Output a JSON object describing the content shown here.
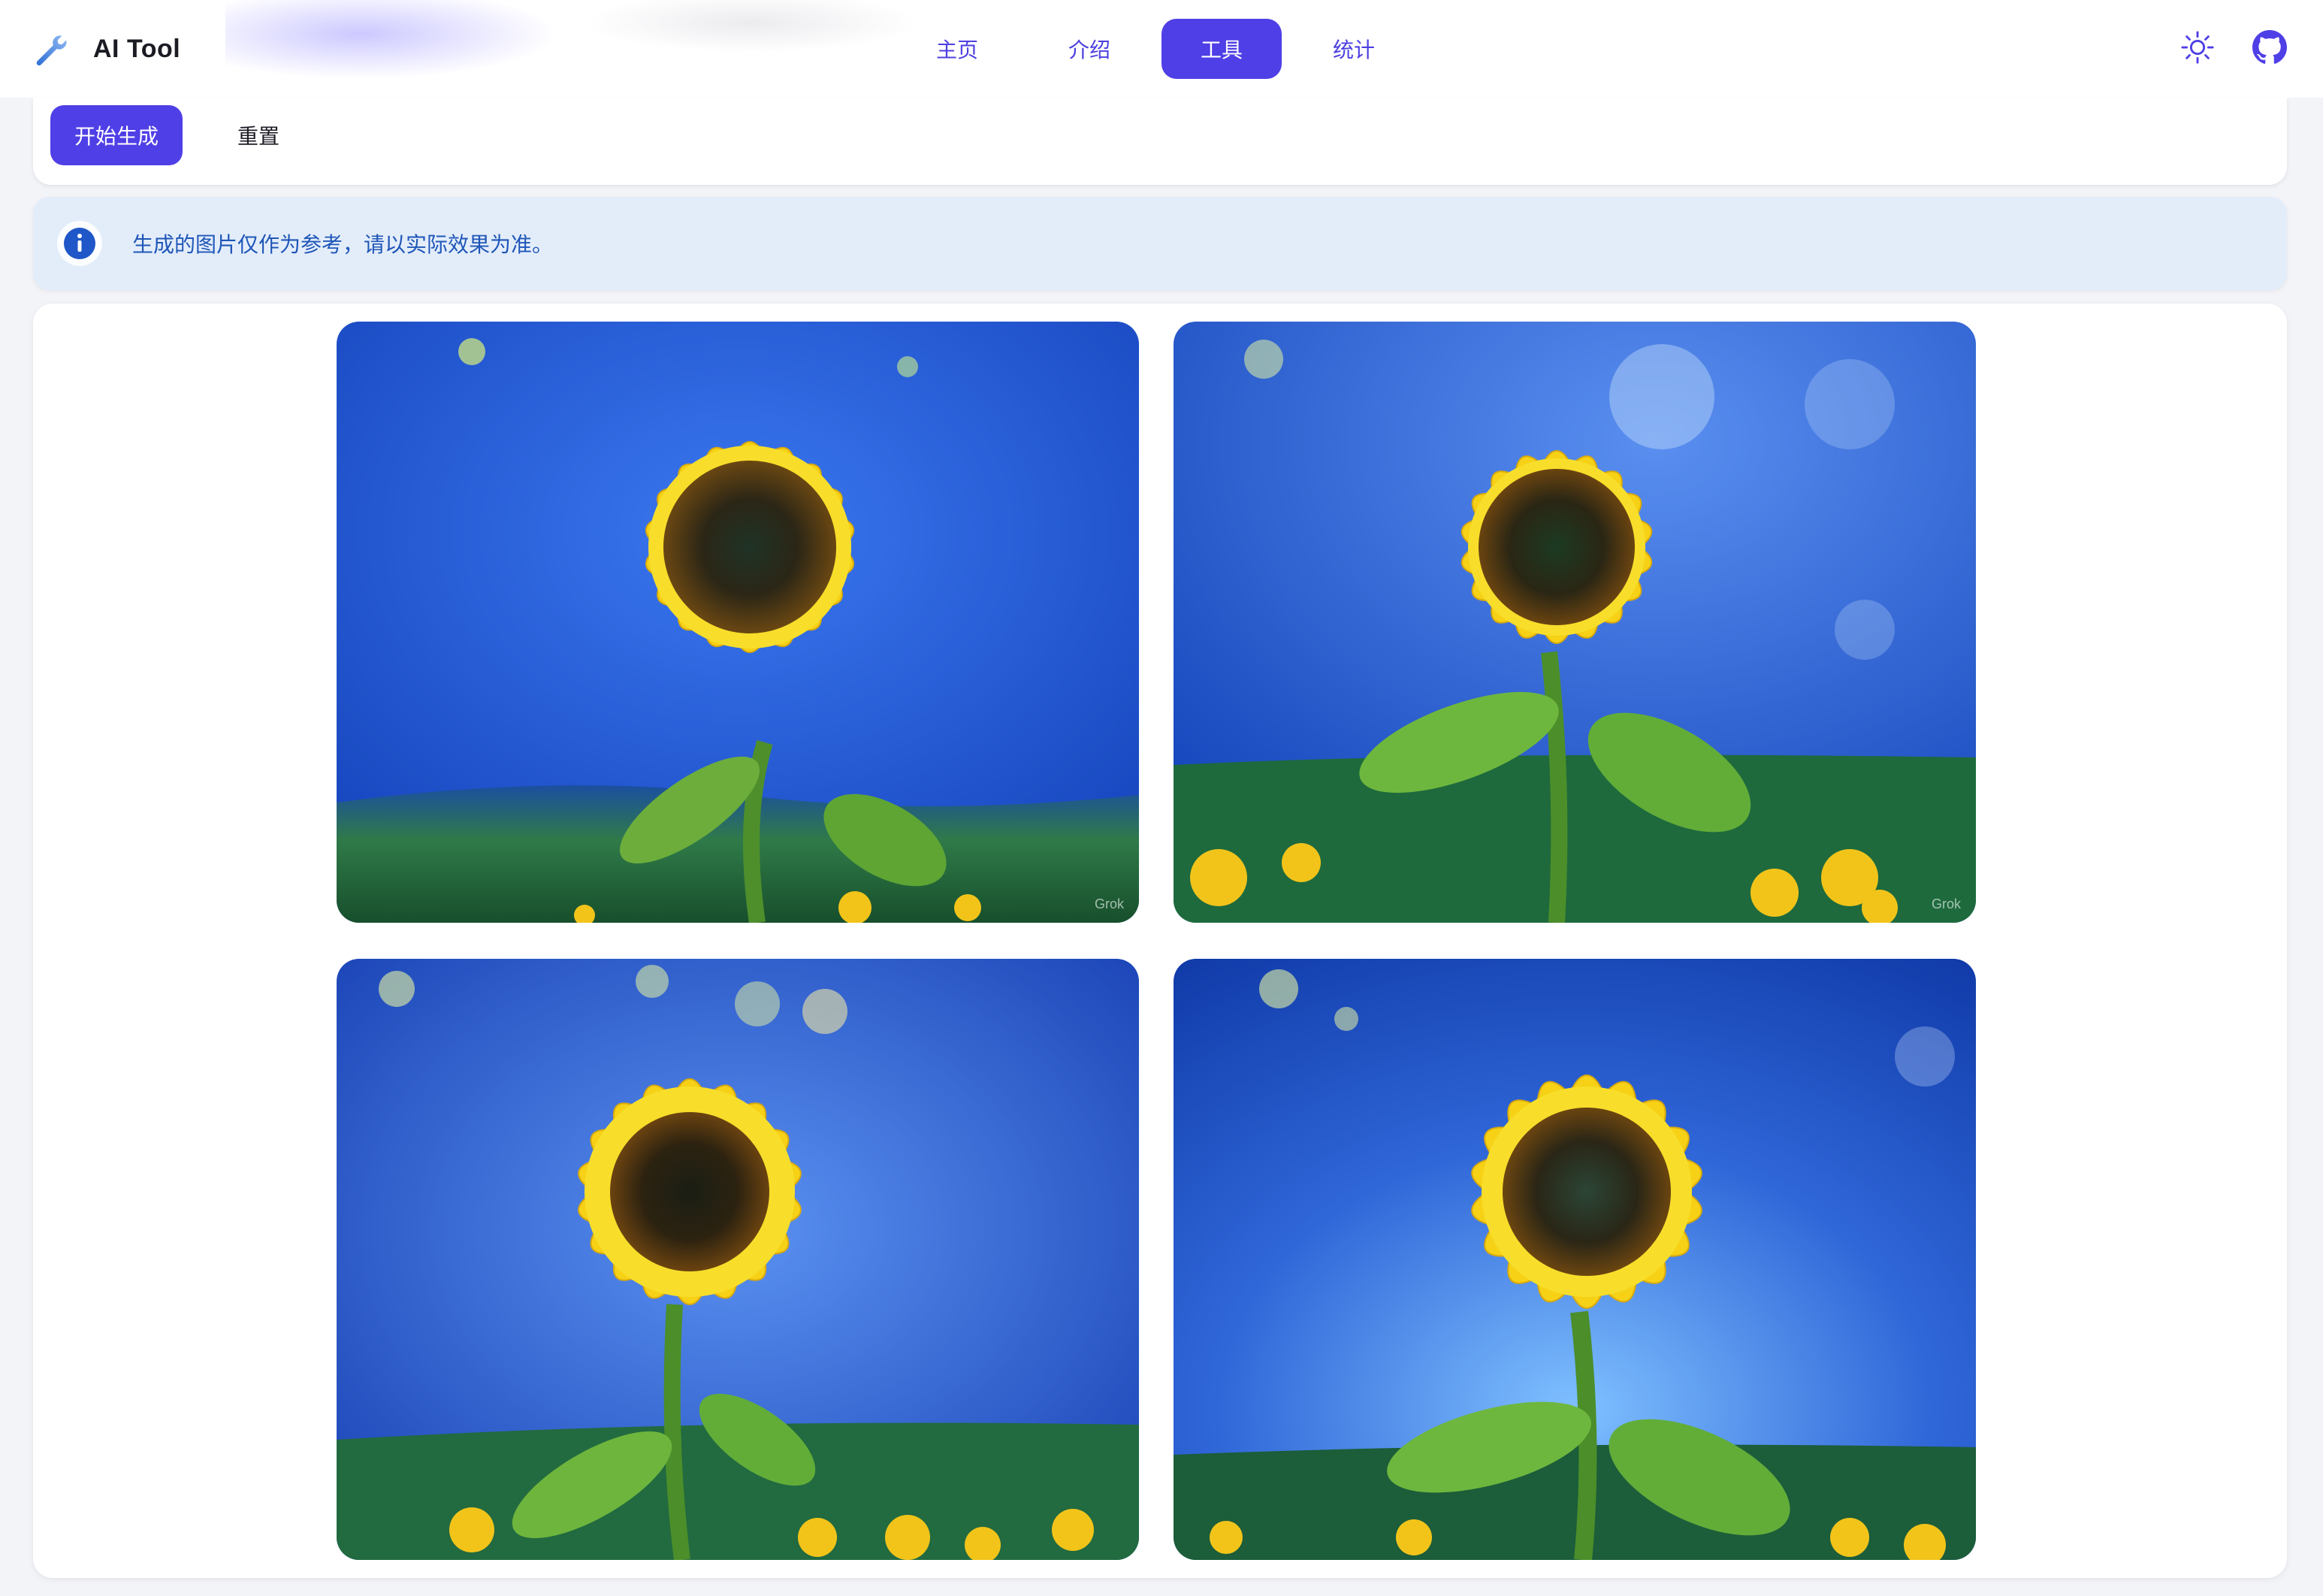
{
  "app": {
    "title": "AI Tool",
    "logo_icon": "wrench-icon"
  },
  "nav": {
    "items": [
      {
        "label": "主页",
        "active": false
      },
      {
        "label": "介绍",
        "active": false
      },
      {
        "label": "工具",
        "active": true
      },
      {
        "label": "统计",
        "active": false
      }
    ]
  },
  "header_actions": {
    "theme_icon": "sun-icon",
    "repo_icon": "github-icon"
  },
  "controls": {
    "generate_label": "开始生成",
    "reset_label": "重置"
  },
  "notice": {
    "icon": "info-icon",
    "text": "生成的图片仅作为参考，请以实际效果为准。"
  },
  "gallery": {
    "images": [
      {
        "subject": "sunflower under starry night sky",
        "watermark": "Grok"
      },
      {
        "subject": "sunflower under starry night sky",
        "watermark": "Grok"
      },
      {
        "subject": "sunflower under starry night sky",
        "watermark": ""
      },
      {
        "subject": "sunflower under starry night sky",
        "watermark": ""
      }
    ]
  },
  "colors": {
    "accent": "#4f3fe6",
    "notice_bg": "#e3edfa",
    "notice_text": "#1f56b8"
  }
}
